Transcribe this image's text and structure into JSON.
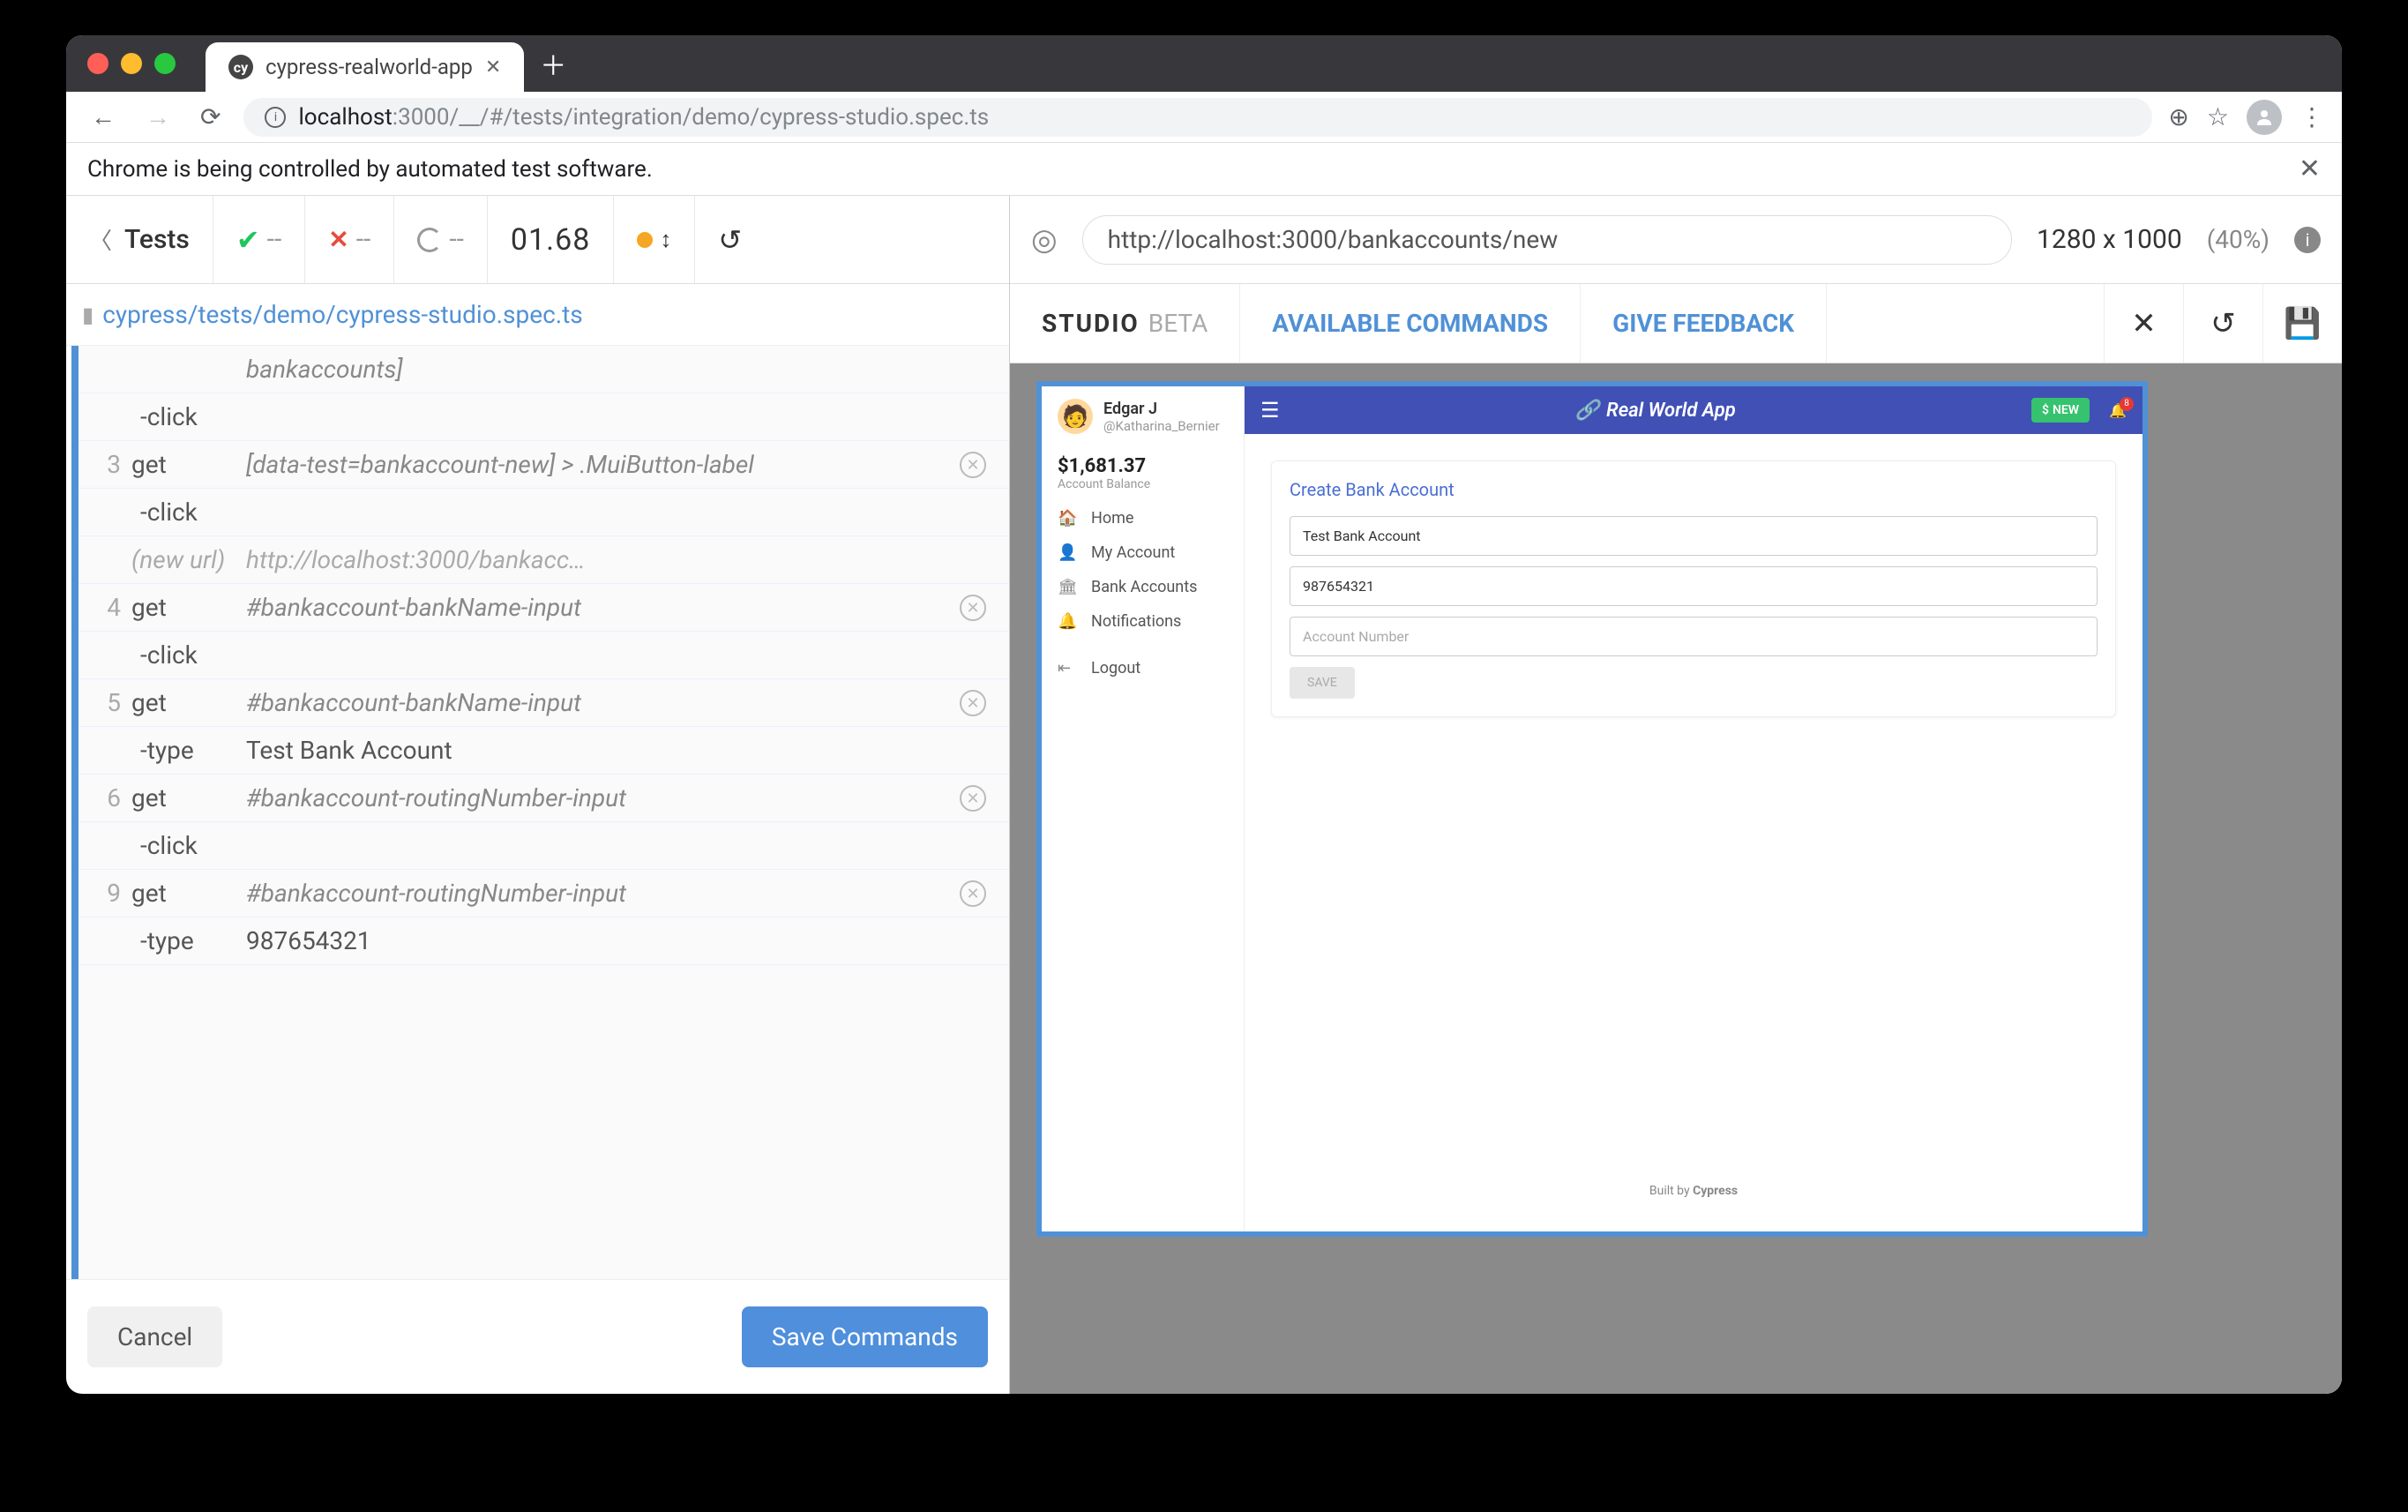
{
  "browser": {
    "tab_title": "cypress-realworld-app",
    "url_host": "localhost",
    "url_port": ":3000",
    "url_path": "/__/#/tests/integration/demo/cypress-studio.spec.ts",
    "infobar": "Chrome is being controlled by automated test software."
  },
  "runner": {
    "tests_label": "Tests",
    "pass_count": "--",
    "fail_count": "--",
    "pending_count": "--",
    "duration": "01.68",
    "file_path": "cypress/tests/demo/cypress-studio.spec.ts"
  },
  "commands": [
    {
      "num": "",
      "cmd": "",
      "arg": "bankaccounts]",
      "del": false,
      "sub": false
    },
    {
      "num": "",
      "cmd": "-click",
      "arg": "",
      "del": false,
      "sub": true
    },
    {
      "num": "3",
      "cmd": "get",
      "arg": "[data-test=bankaccount-new] > .MuiButton-label",
      "del": true,
      "sub": false
    },
    {
      "num": "",
      "cmd": "-click",
      "arg": "",
      "del": false,
      "sub": true
    },
    {
      "num": "",
      "cmd": "(new url)",
      "arg": "http://localhost:3000/bankacc…",
      "del": false,
      "sub": false,
      "note": true
    },
    {
      "num": "4",
      "cmd": "get",
      "arg": "#bankaccount-bankName-input",
      "del": true,
      "sub": false
    },
    {
      "num": "",
      "cmd": "-click",
      "arg": "",
      "del": false,
      "sub": true
    },
    {
      "num": "5",
      "cmd": "get",
      "arg": "#bankaccount-bankName-input",
      "del": true,
      "sub": false
    },
    {
      "num": "",
      "cmd": "-type",
      "arg": "Test Bank Account",
      "del": false,
      "sub": true
    },
    {
      "num": "6",
      "cmd": "get",
      "arg": "#bankaccount-routingNumber-input",
      "del": true,
      "sub": false
    },
    {
      "num": "",
      "cmd": "-click",
      "arg": "",
      "del": false,
      "sub": true
    },
    {
      "num": "9",
      "cmd": "get",
      "arg": "#bankaccount-routingNumber-input",
      "del": true,
      "sub": false
    },
    {
      "num": "",
      "cmd": "-type",
      "arg": "987654321",
      "del": false,
      "sub": true
    }
  ],
  "footer": {
    "cancel": "Cancel",
    "save": "Save Commands"
  },
  "preview": {
    "url": "http://localhost:3000/bankaccounts/new",
    "dims": "1280 x 1000",
    "pct": "(40%)"
  },
  "studio": {
    "label": "STUDIO",
    "beta": "BETA",
    "available": "AVAILABLE COMMANDS",
    "feedback": "GIVE FEEDBACK"
  },
  "app": {
    "user_name": "Edgar J",
    "user_handle": "@Katharina_Bernier",
    "balance": "$1,681.37",
    "balance_label": "Account Balance",
    "nav": [
      "Home",
      "My Account",
      "Bank Accounts",
      "Notifications",
      "Logout"
    ],
    "title": "Real World App",
    "new_btn": "NEW",
    "bell_count": "8",
    "card_title": "Create Bank Account",
    "bank_name": "Test Bank Account",
    "routing": "987654321",
    "acct_placeholder": "Account Number",
    "save_btn": "SAVE",
    "built_by": "Built by",
    "built_brand": "Cypress"
  }
}
